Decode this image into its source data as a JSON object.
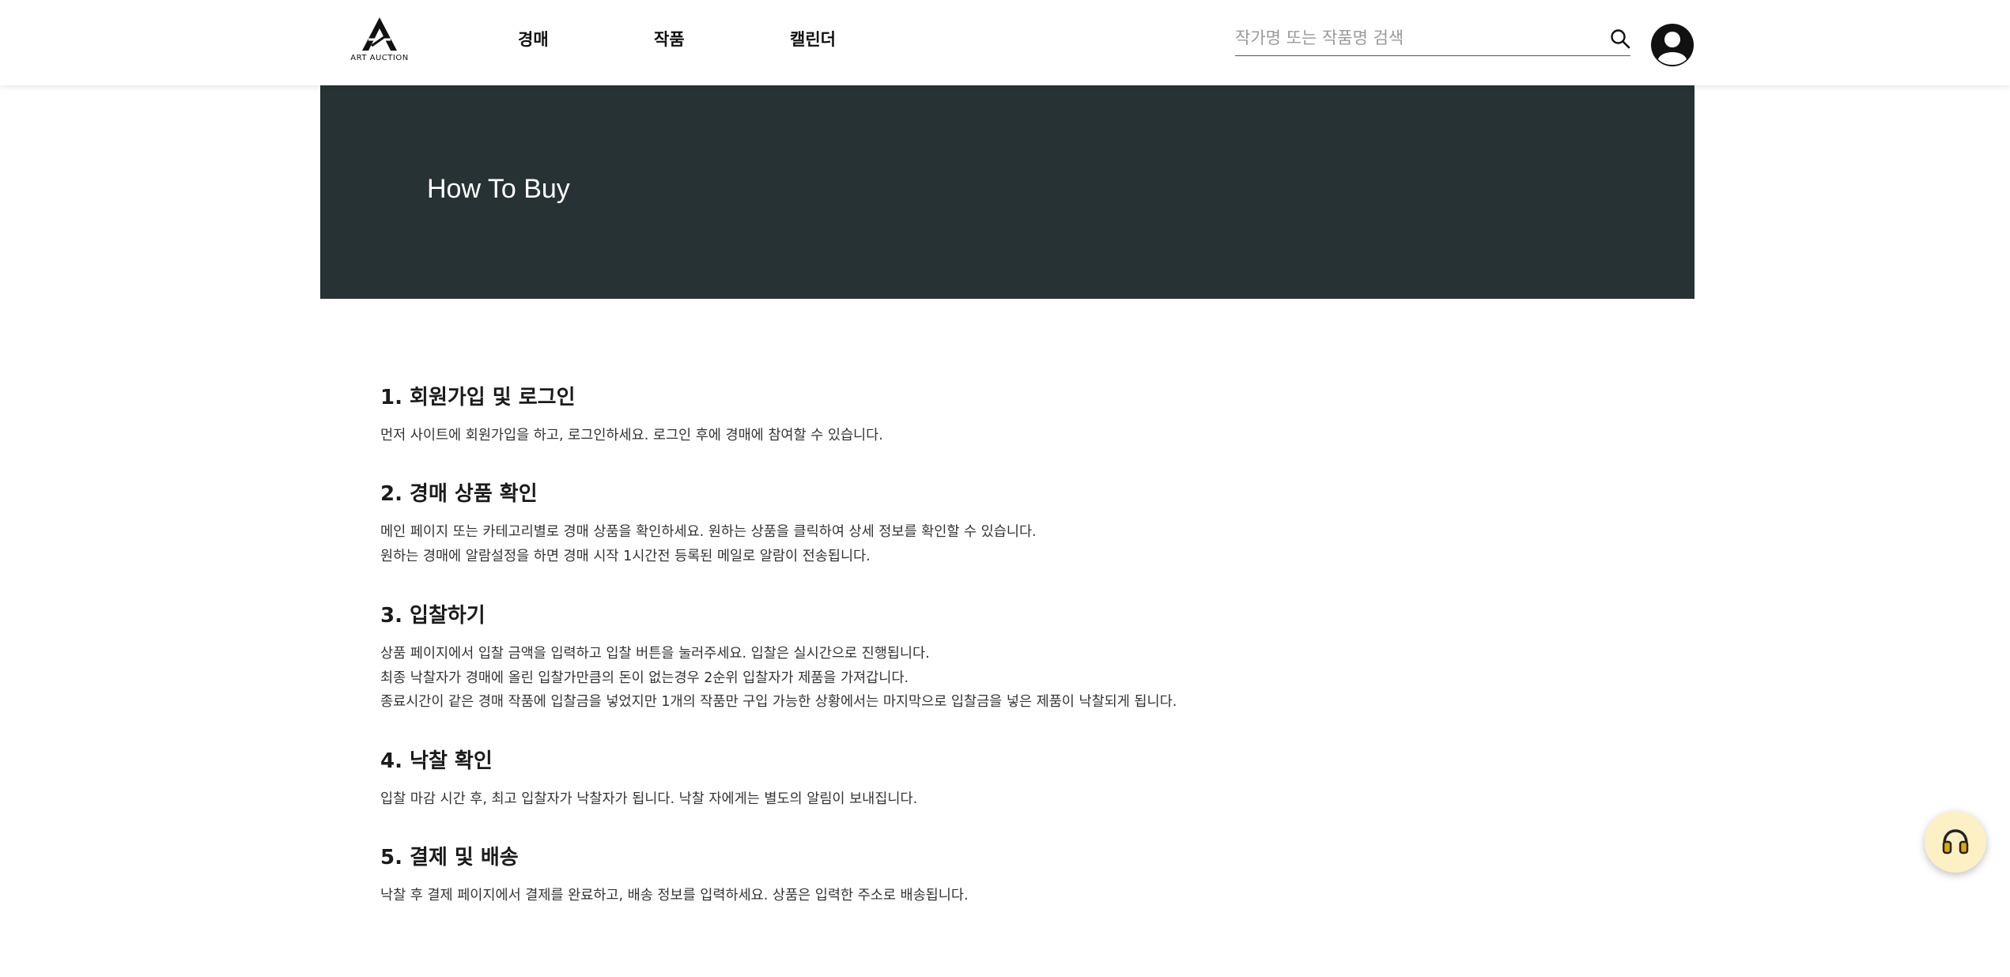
{
  "header": {
    "logo_text": "ART AUCTION",
    "nav": [
      {
        "label": "경매"
      },
      {
        "label": "작품"
      },
      {
        "label": "캘린더"
      }
    ],
    "search": {
      "placeholder": "작가명 또는 작품명 검색",
      "value": ""
    },
    "search_icon": "search-icon",
    "avatar_icon": "user-avatar-icon"
  },
  "hero": {
    "title": "How To Buy"
  },
  "sections": [
    {
      "title": "1. 회원가입 및 로그인",
      "paragraphs": [
        "먼저 사이트에 회원가입을 하고, 로그인하세요. 로그인 후에 경매에 참여할 수 있습니다."
      ]
    },
    {
      "title": "2. 경매 상품 확인",
      "paragraphs": [
        "메인 페이지 또는 카테고리별로 경매 상품을 확인하세요. 원하는 상품을 클릭하여 상세 정보를 확인할 수 있습니다.",
        "원하는 경매에 알람설정을 하면 경매 시작 1시간전 등록된 메일로 알람이 전송됩니다."
      ]
    },
    {
      "title": "3. 입찰하기",
      "paragraphs": [
        "상품 페이지에서 입찰 금액을 입력하고 입찰 버튼을 눌러주세요. 입찰은 실시간으로 진행됩니다.",
        "최종 낙찰자가 경매에 올린 입찰가만큼의 돈이 없는경우 2순위 입찰자가 제품을 가져갑니다.",
        "종료시간이 같은 경매 작품에 입찰금을 넣었지만 1개의 작품만 구입 가능한 상황에서는 마지막으로 입찰금을 넣은 제품이 낙찰되게 됩니다."
      ]
    },
    {
      "title": "4. 낙찰 확인",
      "paragraphs": [
        "입찰 마감 시간 후, 최고 입찰자가 낙찰자가 됩니다. 낙찰 자에게는 별도의 알림이 보내집니다."
      ]
    },
    {
      "title": "5. 결제 및 배송",
      "paragraphs": [
        "낙찰 후 결제 페이지에서 결제를 완료하고, 배송 정보를 입력하세요. 상품은 입력한 주소로 배송됩니다."
      ]
    }
  ],
  "support_button": {
    "icon": "headset-icon"
  },
  "colors": {
    "hero_bg": "#263234",
    "support_bg": "#fdf0c4",
    "support_icon": "#e0a800"
  }
}
